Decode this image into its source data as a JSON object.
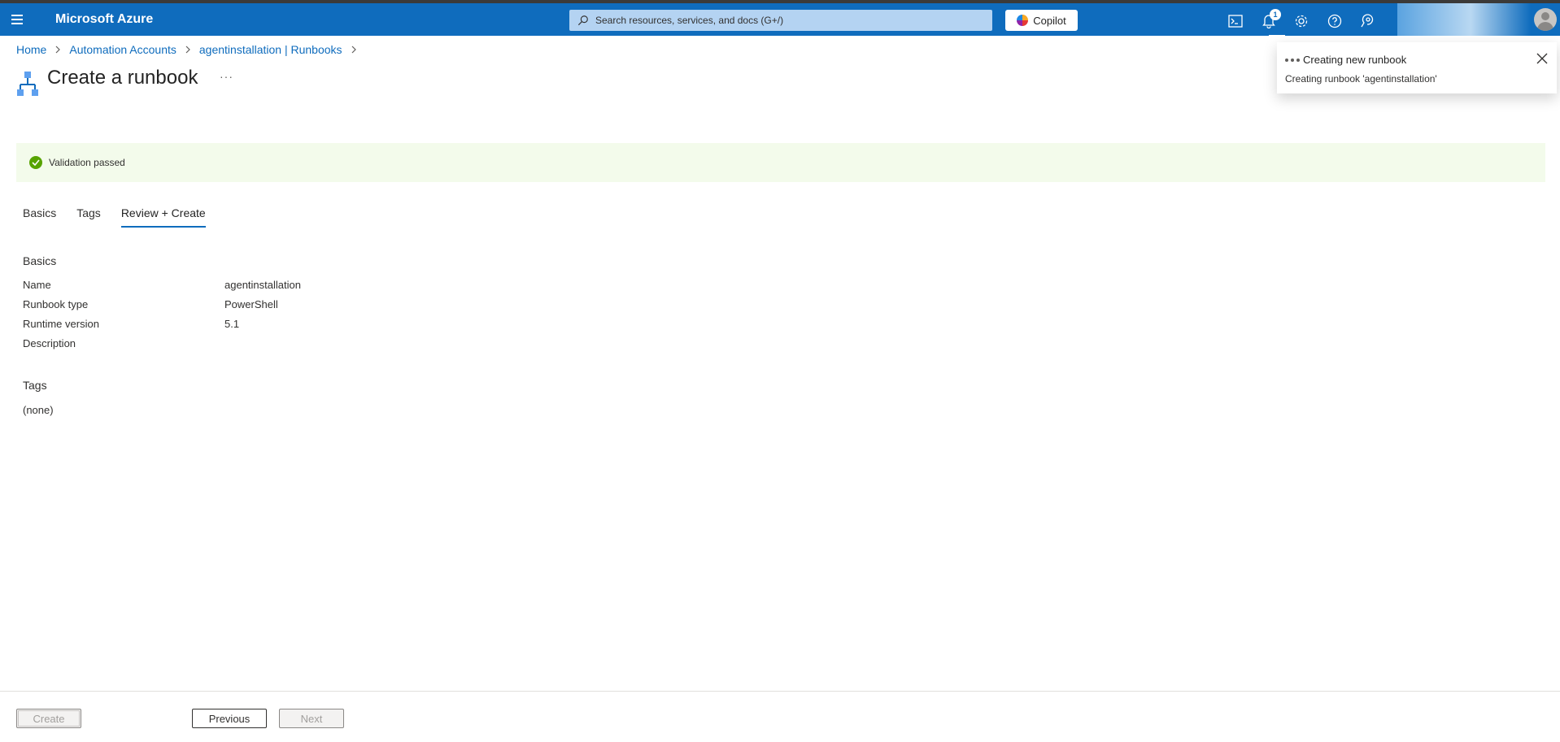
{
  "topbar": {
    "brand": "Microsoft Azure",
    "search_placeholder": "Search resources, services, and docs (G+/)",
    "copilot_label": "Copilot",
    "notification_count": "1"
  },
  "breadcrumb": {
    "items": [
      "Home",
      "Automation Accounts",
      "agentinstallation | Runbooks"
    ]
  },
  "page": {
    "title": "Create a runbook",
    "more": "···"
  },
  "validation": {
    "text": "Validation passed",
    "color": "#57a300"
  },
  "tabs": [
    "Basics",
    "Tags",
    "Review + Create"
  ],
  "summary": {
    "basics_heading": "Basics",
    "rows": [
      {
        "label": "Name",
        "value": "agentinstallation"
      },
      {
        "label": "Runbook type",
        "value": "PowerShell"
      },
      {
        "label": "Runtime version",
        "value": "5.1"
      },
      {
        "label": "Description",
        "value": ""
      }
    ],
    "tags_heading": "Tags",
    "tags_value": "(none)"
  },
  "footer": {
    "create_label": "Create",
    "previous_label": "Previous",
    "next_label": "Next"
  },
  "toast": {
    "title": "Creating new runbook",
    "message": "Creating runbook 'agentinstallation'"
  },
  "colors": {
    "accent": "#0f6cbd",
    "link": "#0f6cbd"
  }
}
